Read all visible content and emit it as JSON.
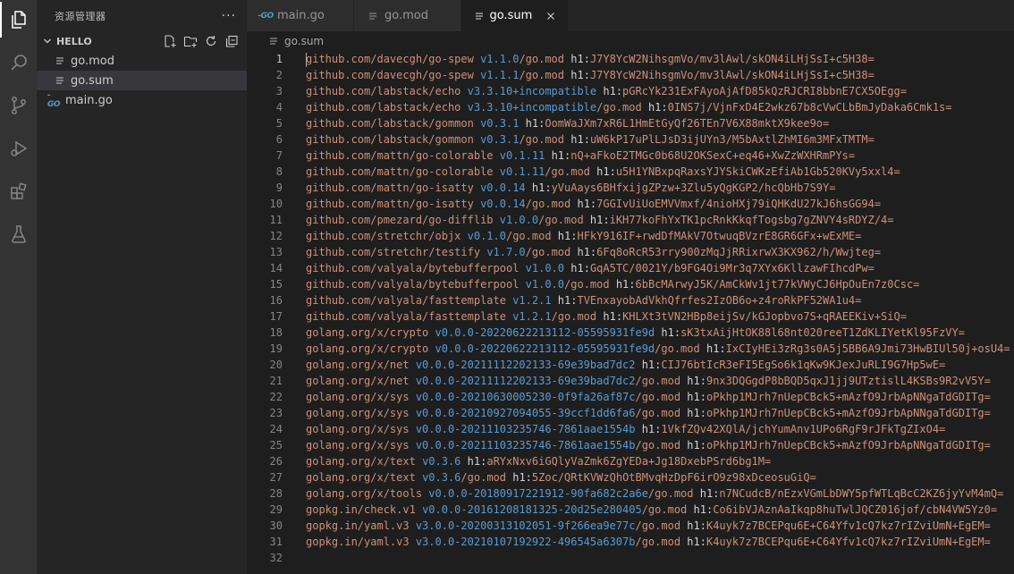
{
  "colors": {
    "module": "#ce9178",
    "version": "#569cd6",
    "hash_key": "#d4d4d4",
    "line_number": "#858585"
  },
  "sidebar": {
    "title": "资源管理器",
    "more": "···",
    "folder": "HELLO",
    "files": [
      {
        "name": "go.mod",
        "icon": "lines-file-icon"
      },
      {
        "name": "go.sum",
        "icon": "lines-file-icon",
        "selected": true
      },
      {
        "name": "main.go",
        "icon": "go-file-icon"
      }
    ]
  },
  "tabs": [
    {
      "label": "main.go",
      "icon": "go-file-icon"
    },
    {
      "label": "go.mod",
      "icon": "lines-file-icon"
    },
    {
      "label": "go.sum",
      "icon": "lines-file-icon",
      "active": true
    }
  ],
  "breadcrumb": {
    "file": "go.sum"
  },
  "go_icon_text": "-GO",
  "editor": {
    "lines": [
      {
        "n": "1",
        "module": "github.com/davecgh/go-spew",
        "version": "v1.1.0",
        "suffix": "/go.mod",
        "key": "h1:",
        "hash": "J7Y8YcW2NihsgmVo/mv3lAwl/skON4iLHjSsI+c5H38="
      },
      {
        "n": "2",
        "module": "github.com/davecgh/go-spew",
        "version": "v1.1.1",
        "suffix": "/go.mod",
        "key": "h1:",
        "hash": "J7Y8YcW2NihsgmVo/mv3lAwl/skON4iLHjSsI+c5H38="
      },
      {
        "n": "3",
        "module": "github.com/labstack/echo",
        "version": "v3.3.10+incompatible",
        "suffix": "",
        "key": "h1:",
        "hash": "pGRcYk231ExFAyoAjAfD85kQzRJCRI8bbnE7CX5OEgg="
      },
      {
        "n": "4",
        "module": "github.com/labstack/echo",
        "version": "v3.3.10+incompatible",
        "suffix": "/go.mod",
        "key": "h1:",
        "hash": "0INS7j/VjnFxD4E2wkz67b8cVwCLbBmJyDaka6Cmk1s="
      },
      {
        "n": "5",
        "module": "github.com/labstack/gommon",
        "version": "v0.3.1",
        "suffix": "",
        "key": "h1:",
        "hash": "OomWaJXm7xR6L1HmEtGyQf26TEn7V6X88mktX9kee9o="
      },
      {
        "n": "6",
        "module": "github.com/labstack/gommon",
        "version": "v0.3.1",
        "suffix": "/go.mod",
        "key": "h1:",
        "hash": "uW6kP17uPlLJsD3ijUYn3/M5bAxtlZhMI6m3MFxTMTM="
      },
      {
        "n": "7",
        "module": "github.com/mattn/go-colorable",
        "version": "v0.1.11",
        "suffix": "",
        "key": "h1:",
        "hash": "nQ+aFkoE2TMGc0b68U2OKSexC+eq46+XwZzWXHRmPYs="
      },
      {
        "n": "8",
        "module": "github.com/mattn/go-colorable",
        "version": "v0.1.11",
        "suffix": "/go.mod",
        "key": "h1:",
        "hash": "u5H1YNBxpqRaxsYJYSkiCWKzEfiAb1Gb520KVy5xxl4="
      },
      {
        "n": "9",
        "module": "github.com/mattn/go-isatty",
        "version": "v0.0.14",
        "suffix": "",
        "key": "h1:",
        "hash": "yVuAays6BHfxijgZPzw+3Zlu5yQgKGP2/hcQbHb7S9Y="
      },
      {
        "n": "10",
        "module": "github.com/mattn/go-isatty",
        "version": "v0.0.14",
        "suffix": "/go.mod",
        "key": "h1:",
        "hash": "7GGIvUiUoEMVVmxf/4nioHXj79iQHKdU27kJ6hsGG94="
      },
      {
        "n": "11",
        "module": "github.com/pmezard/go-difflib",
        "version": "v1.0.0",
        "suffix": "/go.mod",
        "key": "h1:",
        "hash": "iKH77koFhYxTK1pcRnkKkqfTogsbg7gZNVY4sRDYZ/4="
      },
      {
        "n": "12",
        "module": "github.com/stretchr/objx",
        "version": "v0.1.0",
        "suffix": "/go.mod",
        "key": "h1:",
        "hash": "HFkY916IF+rwdDfMAkV7OtwuqBVzrE8GR6GFx+wExME="
      },
      {
        "n": "13",
        "module": "github.com/stretchr/testify",
        "version": "v1.7.0",
        "suffix": "/go.mod",
        "key": "h1:",
        "hash": "6Fq8oRcR53rry900zMqJjRRixrwX3KX962/h/Wwjteg="
      },
      {
        "n": "14",
        "module": "github.com/valyala/bytebufferpool",
        "version": "v1.0.0",
        "suffix": "",
        "key": "h1:",
        "hash": "GqA5TC/0021Y/b9FG4Oi9Mr3q7XYx6KllzawFIhcdPw="
      },
      {
        "n": "15",
        "module": "github.com/valyala/bytebufferpool",
        "version": "v1.0.0",
        "suffix": "/go.mod",
        "key": "h1:",
        "hash": "6bBcMArwyJ5K/AmCkWv1jt77kVWyCJ6HpOuEn7z0Csc="
      },
      {
        "n": "16",
        "module": "github.com/valyala/fasttemplate",
        "version": "v1.2.1",
        "suffix": "",
        "key": "h1:",
        "hash": "TVEnxayobAdVkhQfrfes2IzOB6o+z4roRkPF52WA1u4="
      },
      {
        "n": "17",
        "module": "github.com/valyala/fasttemplate",
        "version": "v1.2.1",
        "suffix": "/go.mod",
        "key": "h1:",
        "hash": "KHLXt3tVN2HBp8eijSv/kGJopbvo7S+qRAEEKiv+SiQ="
      },
      {
        "n": "18",
        "module": "golang.org/x/crypto",
        "version": "v0.0.0-20220622213112-05595931fe9d",
        "suffix": "",
        "key": "h1:",
        "hash": "sK3txAijHtOK88l68nt020reeT1ZdKLIYetKl95FzVY="
      },
      {
        "n": "19",
        "module": "golang.org/x/crypto",
        "version": "v0.0.0-20220622213112-05595931fe9d",
        "suffix": "/go.mod",
        "key": "h1:",
        "hash": "IxCIyHEi3zRg3s0A5j5BB6A9Jmi73HwBIUl50j+osU4="
      },
      {
        "n": "20",
        "module": "golang.org/x/net",
        "version": "v0.0.0-20211112202133-69e39bad7dc2",
        "suffix": "",
        "key": "h1:",
        "hash": "CIJ76btIcR3eFI5EgSo6k1qKw9KJexJuRLI9G7Hp5wE="
      },
      {
        "n": "21",
        "module": "golang.org/x/net",
        "version": "v0.0.0-20211112202133-69e39bad7dc2",
        "suffix": "/go.mod",
        "key": "h1:",
        "hash": "9nx3DQGgdP8bBQD5qxJ1jj9UTztislL4KSBs9R2vV5Y="
      },
      {
        "n": "22",
        "module": "golang.org/x/sys",
        "version": "v0.0.0-20210630005230-0f9fa26af87c",
        "suffix": "/go.mod",
        "key": "h1:",
        "hash": "oPkhp1MJrh7nUepCBck5+mAzfO9JrbApNNgaTdGDITg="
      },
      {
        "n": "23",
        "module": "golang.org/x/sys",
        "version": "v0.0.0-20210927094055-39ccf1dd6fa6",
        "suffix": "/go.mod",
        "key": "h1:",
        "hash": "oPkhp1MJrh7nUepCBck5+mAzfO9JrbApNNgaTdGDITg="
      },
      {
        "n": "24",
        "module": "golang.org/x/sys",
        "version": "v0.0.0-20211103235746-7861aae1554b",
        "suffix": "",
        "key": "h1:",
        "hash": "1VkfZQv42XQlA/jchYumAnv1UPo6RgF9rJFkTgZIxO4="
      },
      {
        "n": "25",
        "module": "golang.org/x/sys",
        "version": "v0.0.0-20211103235746-7861aae1554b",
        "suffix": "/go.mod",
        "key": "h1:",
        "hash": "oPkhp1MJrh7nUepCBck5+mAzfO9JrbApNNgaTdGDITg="
      },
      {
        "n": "26",
        "module": "golang.org/x/text",
        "version": "v0.3.6",
        "suffix": "",
        "key": "h1:",
        "hash": "aRYxNxv6iGQlyVaZmk6ZgYEDa+Jg18DxebPSrd6bg1M="
      },
      {
        "n": "27",
        "module": "golang.org/x/text",
        "version": "v0.3.6",
        "suffix": "/go.mod",
        "key": "h1:",
        "hash": "5Zoc/QRtKVWzQhOtBMvqHzDpF6irO9z98xDceosuGiQ="
      },
      {
        "n": "28",
        "module": "golang.org/x/tools",
        "version": "v0.0.0-20180917221912-90fa682c2a6e",
        "suffix": "/go.mod",
        "key": "h1:",
        "hash": "n7NCudcB/nEzxVGmLbDWY5pfWTLqBcC2KZ6jyYvM4mQ="
      },
      {
        "n": "29",
        "module": "gopkg.in/check.v1",
        "version": "v0.0.0-20161208181325-20d25e280405",
        "suffix": "/go.mod",
        "key": "h1:",
        "hash": "Co6ibVJAznAaIkqp8huTwlJQCZ016jof/cbN4VW5Yz0="
      },
      {
        "n": "30",
        "module": "gopkg.in/yaml.v3",
        "version": "v3.0.0-20200313102051-9f266ea9e77c",
        "suffix": "/go.mod",
        "key": "h1:",
        "hash": "K4uyk7z7BCEPqu6E+C64Yfv1cQ7kz7rIZviUmN+EgEM="
      },
      {
        "n": "31",
        "module": "gopkg.in/yaml.v3",
        "version": "v3.0.0-20210107192922-496545a6307b",
        "suffix": "/go.mod",
        "key": "h1:",
        "hash": "K4uyk7z7BCEPqu6E+C64Yfv1cQ7kz7rIZviUmN+EgEM="
      },
      {
        "n": "32",
        "module": "",
        "version": "",
        "suffix": "",
        "key": "",
        "hash": ""
      }
    ]
  }
}
